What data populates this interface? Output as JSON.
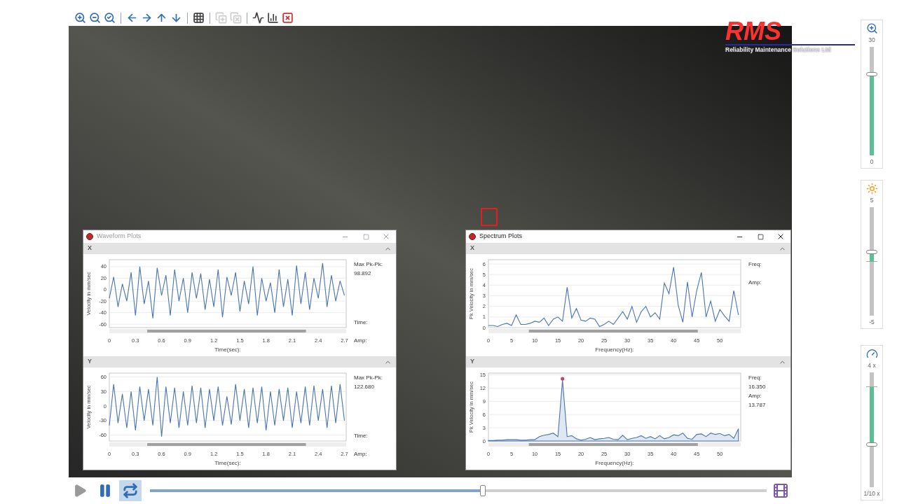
{
  "toolbar": {
    "groups": [
      [
        {
          "kind": "zoom_in",
          "disabled": false
        },
        {
          "kind": "zoom_out",
          "disabled": false
        },
        {
          "kind": "zoom_reset",
          "disabled": false
        }
      ],
      [
        {
          "kind": "left",
          "disabled": false
        },
        {
          "kind": "right",
          "disabled": false
        },
        {
          "kind": "up",
          "disabled": false
        },
        {
          "kind": "down",
          "disabled": false
        }
      ],
      [
        {
          "kind": "grid",
          "disabled": false
        }
      ],
      [
        {
          "kind": "add_region",
          "disabled": true
        },
        {
          "kind": "remove_region",
          "disabled": true
        }
      ],
      [
        {
          "kind": "waveform",
          "disabled": false
        },
        {
          "kind": "spectrum",
          "disabled": false
        },
        {
          "kind": "clear_selection",
          "disabled": false
        }
      ]
    ]
  },
  "logo": {
    "mark": "RMS",
    "tagline": "Reliability Maintenance Solutions Ltd"
  },
  "windows": [
    {
      "kind": "waveform",
      "title": "Waveform Plots",
      "active": false,
      "panels": [
        {
          "axis": "X",
          "expanded": true,
          "readouts": [
            {
              "kind": "peak",
              "label": "Max Pk-Pk:",
              "value": "98.892"
            },
            {
              "kind": "cursor",
              "label": "Time:"
            },
            {
              "kind": "cursor",
              "label": "Amp:"
            }
          ],
          "chart_data": {
            "type": "line",
            "xlabel": "Time(sec):",
            "ylabel": "Velocity in mm/sec",
            "grid": true,
            "x": [
              0,
              0.05,
              0.1,
              0.15,
              0.2,
              0.25,
              0.3,
              0.35,
              0.4,
              0.45,
              0.5,
              0.55,
              0.6,
              0.65,
              0.7,
              0.75,
              0.8,
              0.85,
              0.9,
              0.95,
              1,
              1.05,
              1.1,
              1.15,
              1.2,
              1.25,
              1.3,
              1.35,
              1.4,
              1.45,
              1.5,
              1.55,
              1.6,
              1.65,
              1.7,
              1.75,
              1.8,
              1.85,
              1.9,
              1.95,
              2,
              2.05,
              2.1,
              2.15,
              2.2,
              2.25,
              2.3,
              2.35,
              2.4,
              2.45,
              2.5,
              2.55,
              2.6,
              2.65,
              2.7
            ],
            "series": [
              {
                "color": "#4a74b0",
                "values": [
                  -15,
                  22,
                  -30,
                  10,
                  -20,
                  30,
                  -45,
                  40,
                  -25,
                  15,
                  -50,
                  38,
                  -10,
                  25,
                  -45,
                  35,
                  -20,
                  20,
                  -40,
                  30,
                  -15,
                  28,
                  -35,
                  18,
                  -30,
                  35,
                  -48,
                  22,
                  -10,
                  30,
                  -38,
                  15,
                  -25,
                  40,
                  -45,
                  20,
                  -20,
                  12,
                  -40,
                  35,
                  -30,
                  18,
                  -45,
                  42,
                  -25,
                  30,
                  -35,
                  20,
                  -15,
                  46,
                  -30,
                  25,
                  -20,
                  15,
                  -10
                ]
              }
            ],
            "xlim": [
              0,
              2.72
            ],
            "ylim": [
              -66,
              52
            ],
            "xticks": [
              0,
              0.3,
              0.6,
              0.9,
              1.2,
              1.5,
              1.8,
              2.1,
              2.4,
              2.7
            ],
            "yticks": [
              -60,
              -40,
              -20,
              0,
              20,
              40
            ]
          }
        },
        {
          "axis": "Y",
          "expanded": true,
          "readouts": [
            {
              "kind": "peak",
              "label": "Max Pk-Pk:",
              "value": "122.680"
            },
            {
              "kind": "cursor",
              "label": "Time:"
            },
            {
              "kind": "cursor",
              "label": "Amp:"
            }
          ],
          "chart_data": {
            "type": "line",
            "xlabel": "Time(sec):",
            "ylabel": "Velocity in mm/sec",
            "grid": true,
            "x": [
              0,
              0.05,
              0.1,
              0.15,
              0.2,
              0.25,
              0.3,
              0.35,
              0.4,
              0.45,
              0.5,
              0.55,
              0.6,
              0.65,
              0.7,
              0.75,
              0.8,
              0.85,
              0.9,
              0.95,
              1,
              1.05,
              1.1,
              1.15,
              1.2,
              1.25,
              1.3,
              1.35,
              1.4,
              1.45,
              1.5,
              1.55,
              1.6,
              1.65,
              1.7,
              1.75,
              1.8,
              1.85,
              1.9,
              1.95,
              2,
              2.05,
              2.1,
              2.15,
              2.2,
              2.25,
              2.3,
              2.35,
              2.4,
              2.45,
              2.5,
              2.55,
              2.6,
              2.65,
              2.7
            ],
            "series": [
              {
                "color": "#4a74b0",
                "values": [
                  -40,
                  45,
                  -35,
                  25,
                  -45,
                  30,
                  -50,
                  40,
                  -30,
                  35,
                  -40,
                  60,
                  -63,
                  40,
                  -35,
                  38,
                  -45,
                  30,
                  -40,
                  42,
                  -35,
                  38,
                  -45,
                  35,
                  -30,
                  40,
                  -40,
                  20,
                  -38,
                  45,
                  -30,
                  35,
                  -45,
                  38,
                  -35,
                  40,
                  -50,
                  30,
                  -40,
                  35,
                  -30,
                  38,
                  -45,
                  30,
                  -35,
                  40,
                  -40,
                  42,
                  -30,
                  35,
                  -45,
                  42,
                  -35,
                  45,
                  -30
                ]
              }
            ],
            "xlim": [
              0,
              2.72
            ],
            "ylim": [
              -72,
              68
            ],
            "xticks": [
              0,
              0.3,
              0.6,
              0.9,
              1.2,
              1.5,
              1.8,
              2.1,
              2.4,
              2.7
            ],
            "yticks": [
              -60,
              -30,
              0,
              30,
              60
            ]
          }
        }
      ]
    },
    {
      "kind": "spectrum",
      "title": "Spectrum Plots",
      "active": true,
      "panels": [
        {
          "axis": "X",
          "expanded": true,
          "readouts": [
            {
              "kind": "cursor",
              "label": "Freq:"
            },
            {
              "kind": "cursor",
              "label": "Amp:"
            }
          ],
          "chart_data": {
            "type": "line",
            "xlabel": "Frequency(Hz):",
            "ylabel": "Pk Velocity in mm/sec",
            "grid": true,
            "x": [
              0,
              1,
              2,
              3,
              4,
              5,
              6,
              7,
              8,
              9,
              10,
              11,
              12,
              13,
              14,
              15,
              16,
              17,
              18,
              19,
              20,
              21,
              22,
              23,
              24,
              25,
              26,
              27,
              28,
              29,
              30,
              31,
              32,
              33,
              34,
              35,
              36,
              37,
              38,
              39,
              40,
              41,
              42,
              43,
              44,
              45,
              46,
              47,
              48,
              49,
              50,
              51,
              52,
              53,
              54
            ],
            "series": [
              {
                "color": "#4a74b0",
                "values": [
                  0.2,
                  0.2,
                  0.1,
                  0.3,
                  0.4,
                  0.2,
                  1.2,
                  0.3,
                  0.3,
                  0.4,
                  0.6,
                  0.5,
                  0.9,
                  0.2,
                  0.8,
                  1.0,
                  0.6,
                  3.8,
                  0.9,
                  1.8,
                  0.7,
                  0.6,
                  0.9,
                  0.8,
                  0.1,
                  0.3,
                  0.6,
                  0.3,
                  0.9,
                  1.5,
                  0.8,
                  2.0,
                  0.5,
                  1.5,
                  2.0,
                  1.0,
                  1.4,
                  0.8,
                  4.2,
                  3.2,
                  5.7,
                  2.1,
                  0.5,
                  4.3,
                  1.0,
                  3.5,
                  5.2,
                  1.0,
                  2.5,
                  0.6,
                  1.7,
                  1.1,
                  0.6,
                  3.5,
                  1.2
                ]
              }
            ],
            "xlim": [
              0,
              54.5
            ],
            "ylim": [
              0,
              6.4
            ],
            "xticks": [
              0,
              5,
              10,
              15,
              20,
              25,
              30,
              35,
              40,
              45,
              50
            ],
            "yticks": [
              0,
              1,
              2,
              3,
              4,
              5,
              6
            ]
          }
        },
        {
          "axis": "Y",
          "expanded": true,
          "readouts": [
            {
              "kind": "cursor",
              "label": "Freq:",
              "value": "16.350"
            },
            {
              "kind": "cursor",
              "label": "Amp:",
              "value": "13.787"
            }
          ],
          "chart_data": {
            "type": "area",
            "xlabel": "Frequency(Hz):",
            "ylabel": "Pk Velocity in mm/sec",
            "grid": true,
            "x": [
              0,
              1,
              2,
              3,
              4,
              5,
              6,
              7,
              8,
              9,
              10,
              11,
              12,
              13,
              14,
              15,
              16,
              17,
              18,
              19,
              20,
              21,
              22,
              23,
              24,
              25,
              26,
              27,
              28,
              29,
              30,
              31,
              32,
              33,
              34,
              35,
              36,
              37,
              38,
              39,
              40,
              41,
              42,
              43,
              44,
              45,
              46,
              47,
              48,
              49,
              50,
              51,
              52,
              53,
              54
            ],
            "series": [
              {
                "color": "#4a74b0",
                "values": [
                  0.1,
                  0.1,
                  0.2,
                  0.2,
                  0.3,
                  0.3,
                  0.3,
                  0.2,
                  0.2,
                  0.3,
                  0.3,
                  1.0,
                  1.3,
                  1.5,
                  1.8,
                  1.0,
                  13.8,
                  1.0,
                  1.2,
                  0.5,
                  0.2,
                  0.4,
                  0.8,
                  0.3,
                  0.5,
                  0.6,
                  0.8,
                  0.4,
                  0.3,
                  1.3,
                  0.3,
                  0.6,
                  0.8,
                  1.2,
                  0.6,
                  1.0,
                  0.5,
                  1.2,
                  0.5,
                  0.8,
                  1.4,
                  1.2,
                  1.8,
                  0.6,
                  0.4,
                  1.5,
                  1.6,
                  1.0,
                  1.8,
                  1.5,
                  1.7,
                  1.2,
                  1.5,
                  0.6,
                  2.8
                ]
              }
            ],
            "xlim": [
              0,
              54.5
            ],
            "ylim": [
              0,
              15.4
            ],
            "xticks": [
              0,
              5,
              10,
              15,
              20,
              25,
              30,
              35,
              40,
              45,
              50
            ],
            "yticks": [
              0,
              3,
              6,
              9,
              12,
              15
            ]
          }
        }
      ]
    }
  ],
  "side_sliders": [
    {
      "kind": "zoom",
      "max_label": "30",
      "min_label": "0",
      "level": 0.76
    },
    {
      "kind": "brightness",
      "max_label": "5",
      "min_label": "-5",
      "level": 0.59
    },
    {
      "kind": "speed",
      "max_label": "4 x",
      "min_label": "1/10 x",
      "level": 0.37
    }
  ],
  "playback": {
    "buttons": [
      {
        "kind": "play",
        "selected": false
      },
      {
        "kind": "pause",
        "selected": false
      },
      {
        "kind": "loop",
        "selected": true
      }
    ],
    "timeline": {
      "level": 0.54
    }
  }
}
